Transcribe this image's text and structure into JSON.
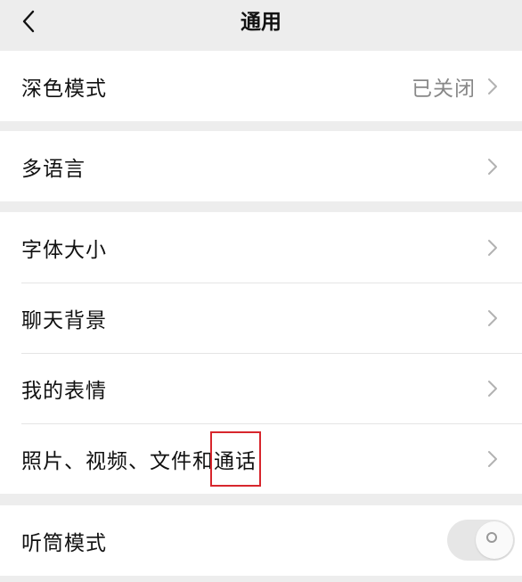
{
  "nav": {
    "title": "通用",
    "back_icon": "chevron-left-icon"
  },
  "groups": [
    {
      "items": [
        {
          "label": "深色模式",
          "value": "已关闭"
        }
      ]
    },
    {
      "items": [
        {
          "label": "多语言"
        }
      ]
    },
    {
      "items": [
        {
          "label": "字体大小"
        },
        {
          "label": "聊天背景"
        },
        {
          "label": "我的表情"
        },
        {
          "label_prefix": "照片、视频、文件和",
          "label_highlight": "通话"
        }
      ]
    },
    {
      "items": [
        {
          "label": "听筒模式",
          "toggle_on": false
        }
      ]
    }
  ],
  "colors": {
    "background": "#ededed",
    "card": "#ffffff",
    "highlight_box": "#d7262d",
    "secondary_text": "#888888"
  }
}
